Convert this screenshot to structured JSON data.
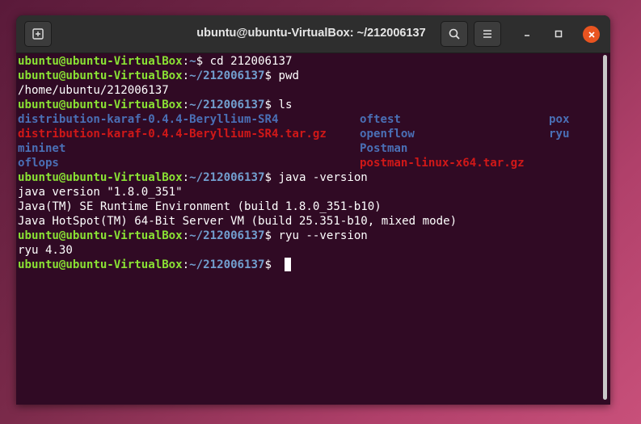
{
  "window": {
    "title": "ubuntu@ubuntu-VirtualBox: ~/212006137"
  },
  "colors": {
    "user": "#8ae234",
    "path": "#729fcf",
    "directory": "#4a6fb5",
    "archive": "#d01818",
    "close": "#e95420",
    "terminal_bg": "#300a24"
  },
  "icons": {
    "new_tab": "new-tab-icon",
    "search": "search-icon",
    "menu": "hamburger-menu-icon",
    "minimize": "minimize-icon",
    "maximize": "maximize-icon",
    "close": "close-icon"
  },
  "prompt": {
    "user_host": "ubuntu@ubuntu-VirtualBox",
    "colon": ":",
    "home_path": "~",
    "dir_path": "~/212006137",
    "symbol": "$ "
  },
  "lines": {
    "cmd_cd": "cd 212006137",
    "cmd_pwd": "pwd",
    "out_pwd": "/home/ubuntu/212006137",
    "cmd_ls": "ls",
    "ls": {
      "col1": [
        "distribution-karaf-0.4.4-Beryllium-SR4",
        "distribution-karaf-0.4.4-Beryllium-SR4.tar.gz",
        "mininet",
        "oflops"
      ],
      "col2": [
        "oftest",
        "openflow",
        "Postman",
        "postman-linux-x64.tar.gz"
      ],
      "col3": [
        "pox",
        "ryu"
      ]
    },
    "cmd_java": "java -version",
    "out_java": [
      "java version \"1.8.0_351\"",
      "Java(TM) SE Runtime Environment (build 1.8.0_351-b10)",
      "Java HotSpot(TM) 64-Bit Server VM (build 25.351-b10, mixed mode)"
    ],
    "cmd_ryu": "ryu --version",
    "out_ryu": "ryu 4.30"
  }
}
